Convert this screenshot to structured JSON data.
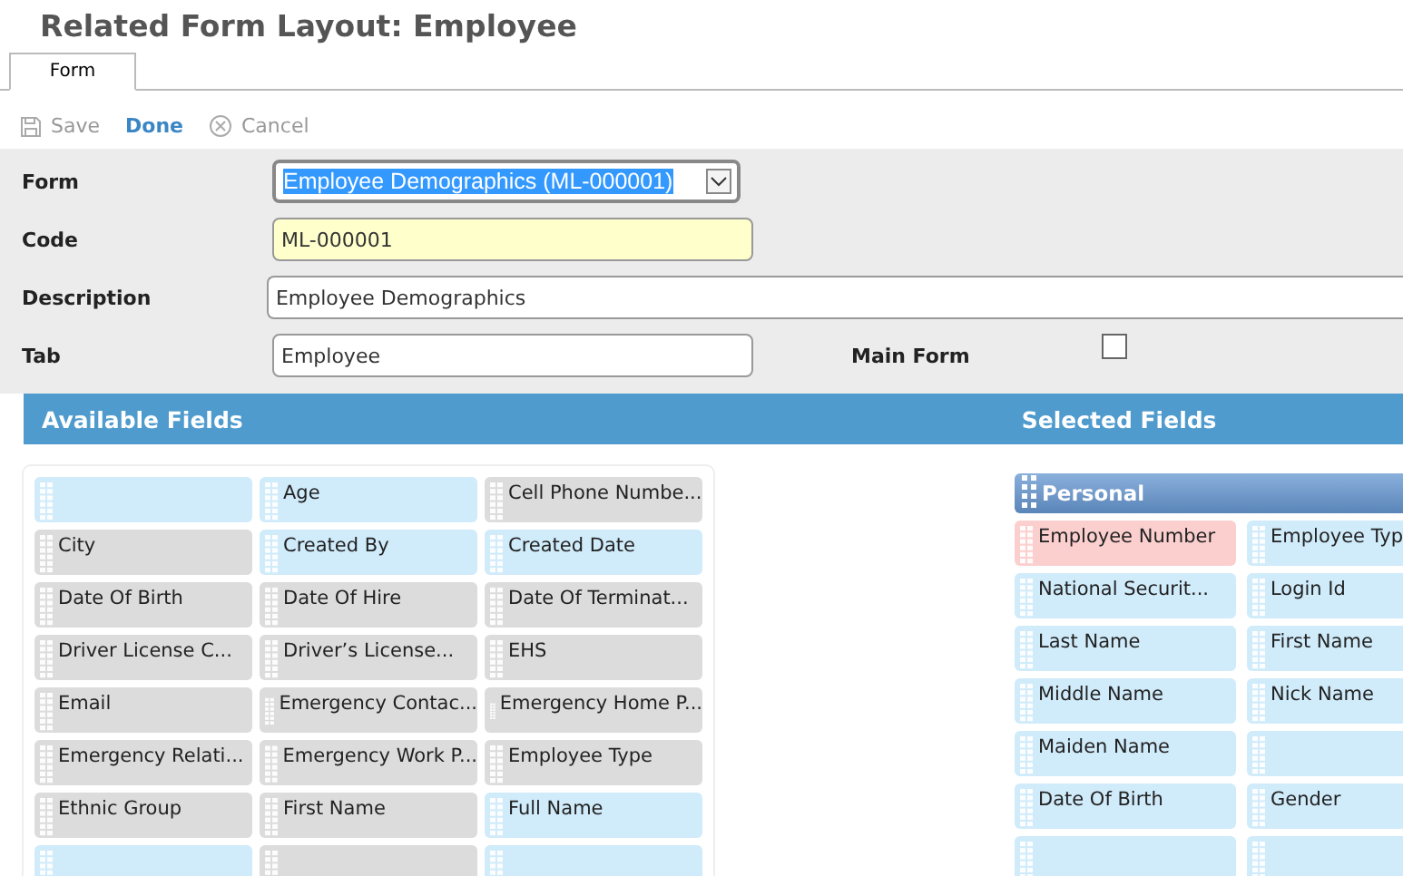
{
  "page": {
    "title": "Related Form Layout: Employee"
  },
  "tabs": [
    {
      "label": "Form",
      "selected": true
    }
  ],
  "toolbar": [
    {
      "kind": "save",
      "label": "Save",
      "disabled": true
    },
    {
      "kind": "done",
      "label": "Done",
      "disabled": false
    },
    {
      "kind": "cancel",
      "label": "Cancel",
      "disabled": true
    }
  ],
  "form": {
    "form_label": "Form",
    "form_value": "Employee Demographics (ML-000001)",
    "code_label": "Code",
    "code_value": "ML-000001",
    "description_label": "Description",
    "description_value": "Employee Demographics",
    "tab_label": "Tab",
    "tab_value": "Employee",
    "main_form_label": "Main Form",
    "main_form_checked": false
  },
  "available_fields": {
    "title": "Available Fields",
    "items": [
      {
        "color": "#d0ebfa"
      },
      {
        "label": "Age",
        "color": "#d0ebfa"
      },
      {
        "label": "Cell Phone Numbe...",
        "color": "#dcdcdc"
      },
      {
        "label": "City",
        "color": "#dcdcdc"
      },
      {
        "label": "Created By",
        "color": "#d0ebfa"
      },
      {
        "label": "Created Date",
        "color": "#d0ebfa"
      },
      {
        "label": "Date Of Birth",
        "color": "#dcdcdc"
      },
      {
        "label": "Date Of Hire",
        "color": "#dcdcdc"
      },
      {
        "label": "Date Of Terminat...",
        "color": "#dcdcdc"
      },
      {
        "label": "Driver License C...",
        "color": "#dcdcdc"
      },
      {
        "label": "Driver’s License...",
        "color": "#dcdcdc"
      },
      {
        "label": "EHS",
        "color": "#dcdcdc"
      },
      {
        "label": "Email",
        "color": "#dcdcdc"
      },
      {
        "label": "Emergency Contac...",
        "color": "#dcdcdc"
      },
      {
        "label": "Emergency Home P...",
        "color": "#dcdcdc"
      },
      {
        "label": "Emergency Relati...",
        "color": "#dcdcdc"
      },
      {
        "label": "Emergency Work P...",
        "color": "#dcdcdc"
      },
      {
        "label": "Employee Type",
        "color": "#dcdcdc"
      },
      {
        "label": "Ethnic Group",
        "color": "#dcdcdc"
      },
      {
        "label": "First Name",
        "color": "#dcdcdc"
      },
      {
        "label": "Full Name",
        "color": "#d0ebfa"
      },
      {
        "color": "#d0ebfa"
      },
      {
        "color": "#dcdcdc"
      },
      {
        "color": "#d0ebfa"
      }
    ]
  },
  "selected_fields": {
    "title": "Selected Fields",
    "section": "Personal",
    "items": [
      {
        "label": "Employee Number",
        "color": "#fccfcf"
      },
      {
        "label": "Employee Typ",
        "color": "#d0ebfa"
      },
      {
        "label": "National Securit...",
        "color": "#d0ebfa"
      },
      {
        "label": "Login Id",
        "color": "#d0ebfa"
      },
      {
        "label": "Last Name",
        "color": "#d0ebfa"
      },
      {
        "label": "First Name",
        "color": "#d0ebfa"
      },
      {
        "label": "Middle Name",
        "color": "#d0ebfa"
      },
      {
        "label": "Nick Name",
        "color": "#d0ebfa"
      },
      {
        "label": "Maiden Name",
        "color": "#d0ebfa"
      },
      {
        "color": "#d0ebfa"
      },
      {
        "label": "Date Of Birth",
        "color": "#d0ebfa"
      },
      {
        "label": "Gender",
        "color": "#d0ebfa"
      },
      {
        "color": "#d0ebfa"
      },
      {
        "color": "#d0ebfa"
      }
    ]
  }
}
